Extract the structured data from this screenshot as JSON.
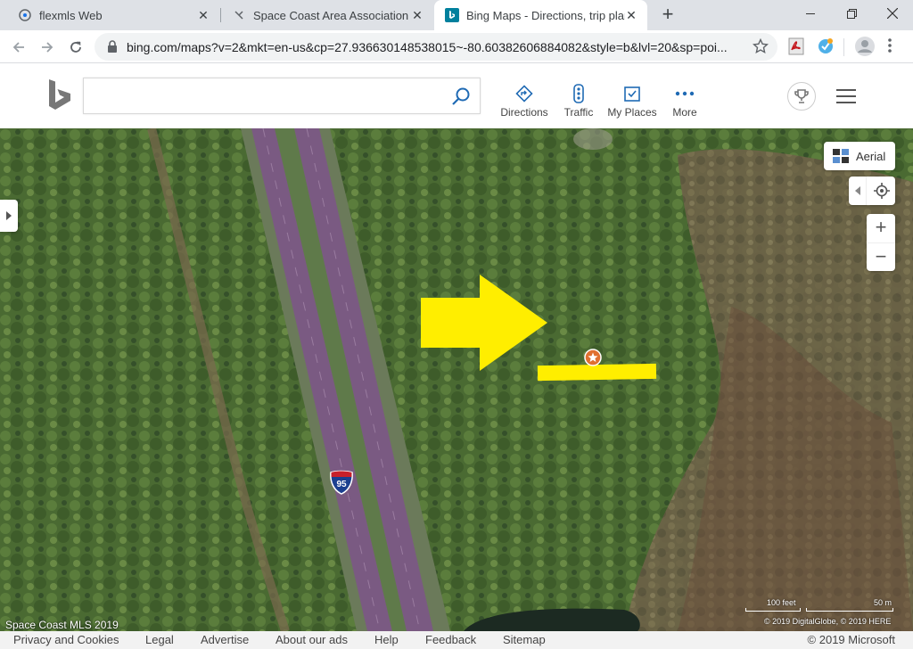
{
  "browser": {
    "tabs": [
      {
        "title": "flexmls Web",
        "favicon": "flexmls-icon"
      },
      {
        "title": "Space Coast Area Association of",
        "favicon": "page-icon"
      },
      {
        "title": "Bing Maps - Directions, trip plann",
        "favicon": "bing-icon",
        "active": true
      }
    ],
    "url": "bing.com/maps?v=2&mkt=en-us&cp=27.936630148538015~-80.60382606884082&style=b&lvl=20&sp=poi..."
  },
  "bing": {
    "search_placeholder": "",
    "nav": [
      {
        "label": "Directions",
        "icon": "directions-icon"
      },
      {
        "label": "Traffic",
        "icon": "traffic-icon"
      },
      {
        "label": "My Places",
        "icon": "my-places-icon"
      },
      {
        "label": "More",
        "icon": "more-icon"
      }
    ]
  },
  "map": {
    "style_button": "Aerial",
    "highway_shield": "95",
    "watermark": "Space Coast MLS 2019",
    "scale": {
      "left": "100 feet",
      "right": "50 m"
    },
    "imagery_credit": "© 2019 DigitalGlobe, © 2019 HERE",
    "colors": {
      "arrow": "#ffee00",
      "pin": "#e07030",
      "highway": "#7a5a82"
    }
  },
  "footer": {
    "links": [
      "Privacy and Cookies",
      "Legal",
      "Advertise",
      "About our ads",
      "Help",
      "Feedback",
      "Sitemap"
    ],
    "copyright": "© 2019 Microsoft"
  }
}
